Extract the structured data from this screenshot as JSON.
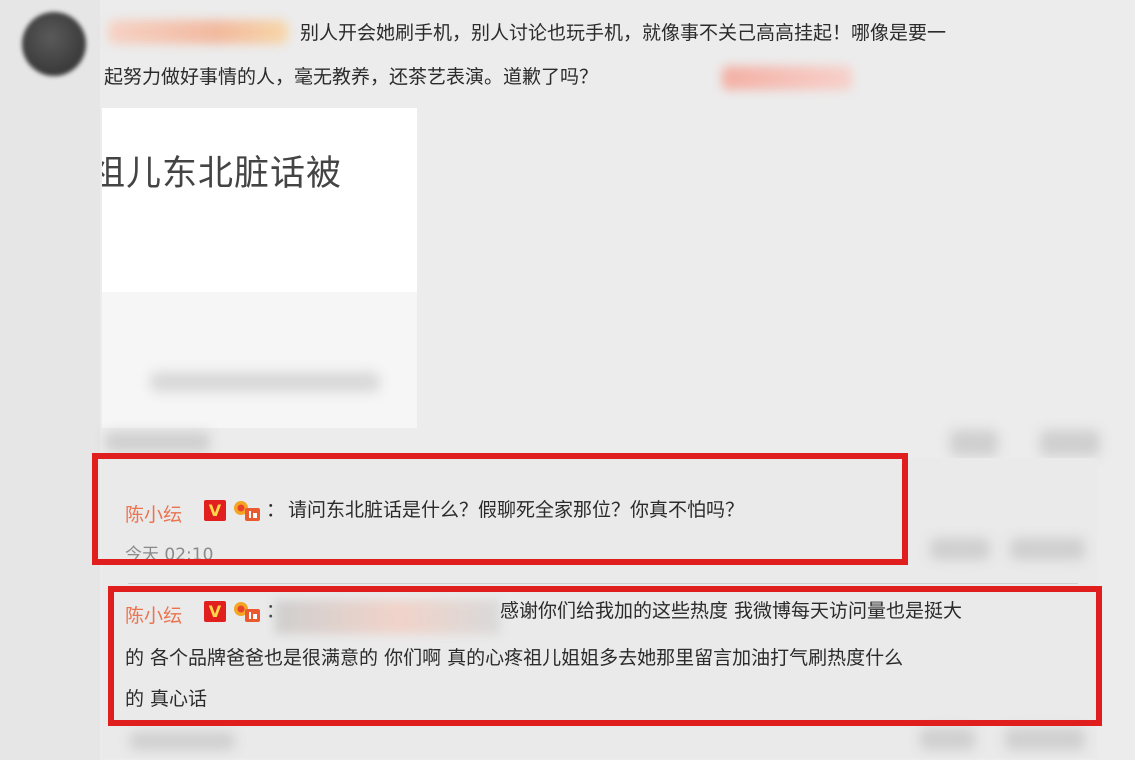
{
  "post": {
    "line1": "别人开会她刷手机，别人讨论也玩手机，就像事不关己高高挂起！哪像是要一",
    "line2": "起努力做好事情的人，毫无教养，还茶艺表演。道歉了吗？"
  },
  "embed": {
    "caption": "祖儿东北脏话被"
  },
  "comments": [
    {
      "username": "陈小纭",
      "verified_badge": "V",
      "separator": "：",
      "text": "请问东北脏话是什么？假聊死全家那位？你真不怕吗？",
      "time": "今天 02:10"
    },
    {
      "username": "陈小纭",
      "verified_badge": "V",
      "separator": "：",
      "lines": [
        "感谢你们给我加的这些热度 我微博每天访问量也是挺大",
        "的 各个品牌爸爸也是很满意的 你们啊 真的心疼祖儿姐姐多去她那里留言加油打气刷热度什么",
        "的 真心话"
      ]
    }
  ],
  "colors": {
    "username": "#eb7350",
    "highlight_box": "#e01e1e",
    "verified_badge_bg": "#e11f1f",
    "verified_badge_fg": "#ffd84a"
  },
  "icons": {
    "verified": "verified-v-icon",
    "medal": "member-medal-icon"
  }
}
